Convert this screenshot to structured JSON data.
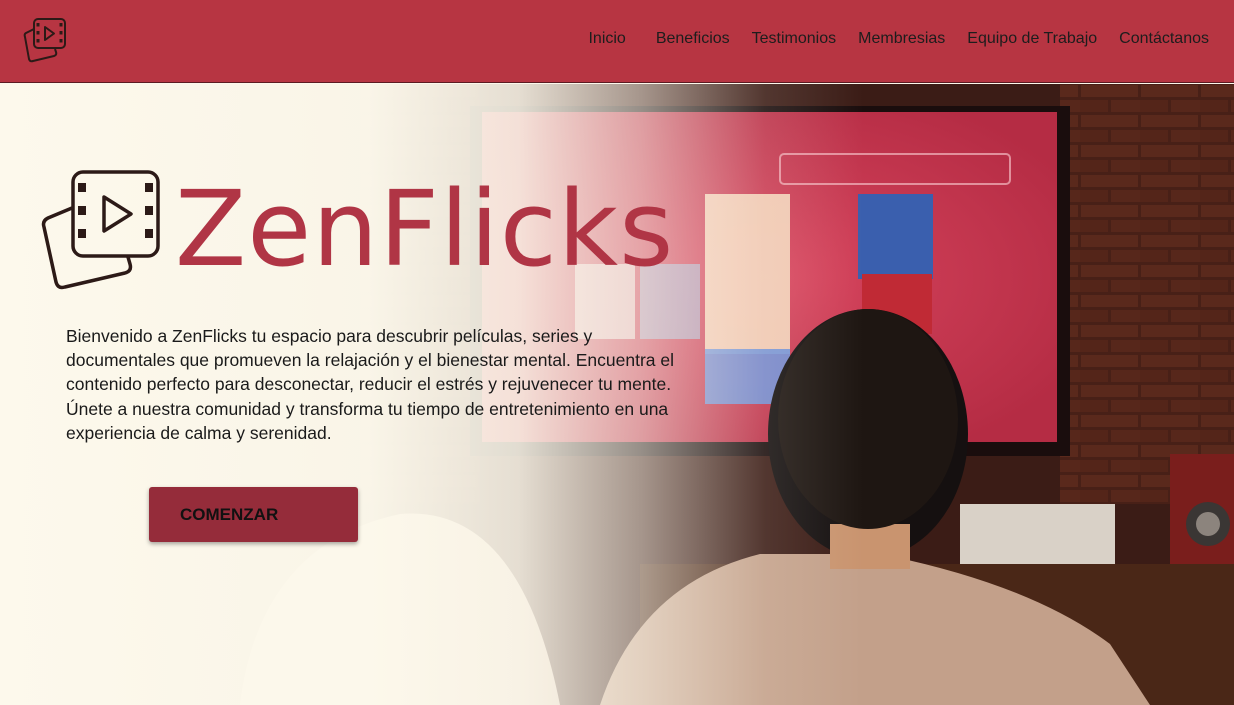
{
  "nav": {
    "logo_icon": "film-frames-icon",
    "links": [
      {
        "label": "Inicio"
      },
      {
        "label": "Beneficios"
      },
      {
        "label": "Testimonios"
      },
      {
        "label": "Membresias"
      },
      {
        "label": "Equipo de Trabajo"
      },
      {
        "label": "Contáctanos"
      }
    ]
  },
  "hero": {
    "brand_name": "ZenFlicks",
    "brand_icon": "film-frames-icon",
    "description": "Bienvenido a ZenFlicks tu espacio para descubrir películas, series y documentales que promueven la relajación y el bienestar mental. Encuentra el contenido perfecto para desconectar, reducir el estrés y rejuvenecer tu mente. Únete a nuestra comunidad y transforma tu tiempo de entretenimiento en una experiencia de calma y serenidad.",
    "cta_label": "COMENZAR"
  },
  "colors": {
    "brand": "#b73542",
    "brand_text": "#b03545",
    "button": "#952c3a",
    "background": "#fcf8ec"
  }
}
